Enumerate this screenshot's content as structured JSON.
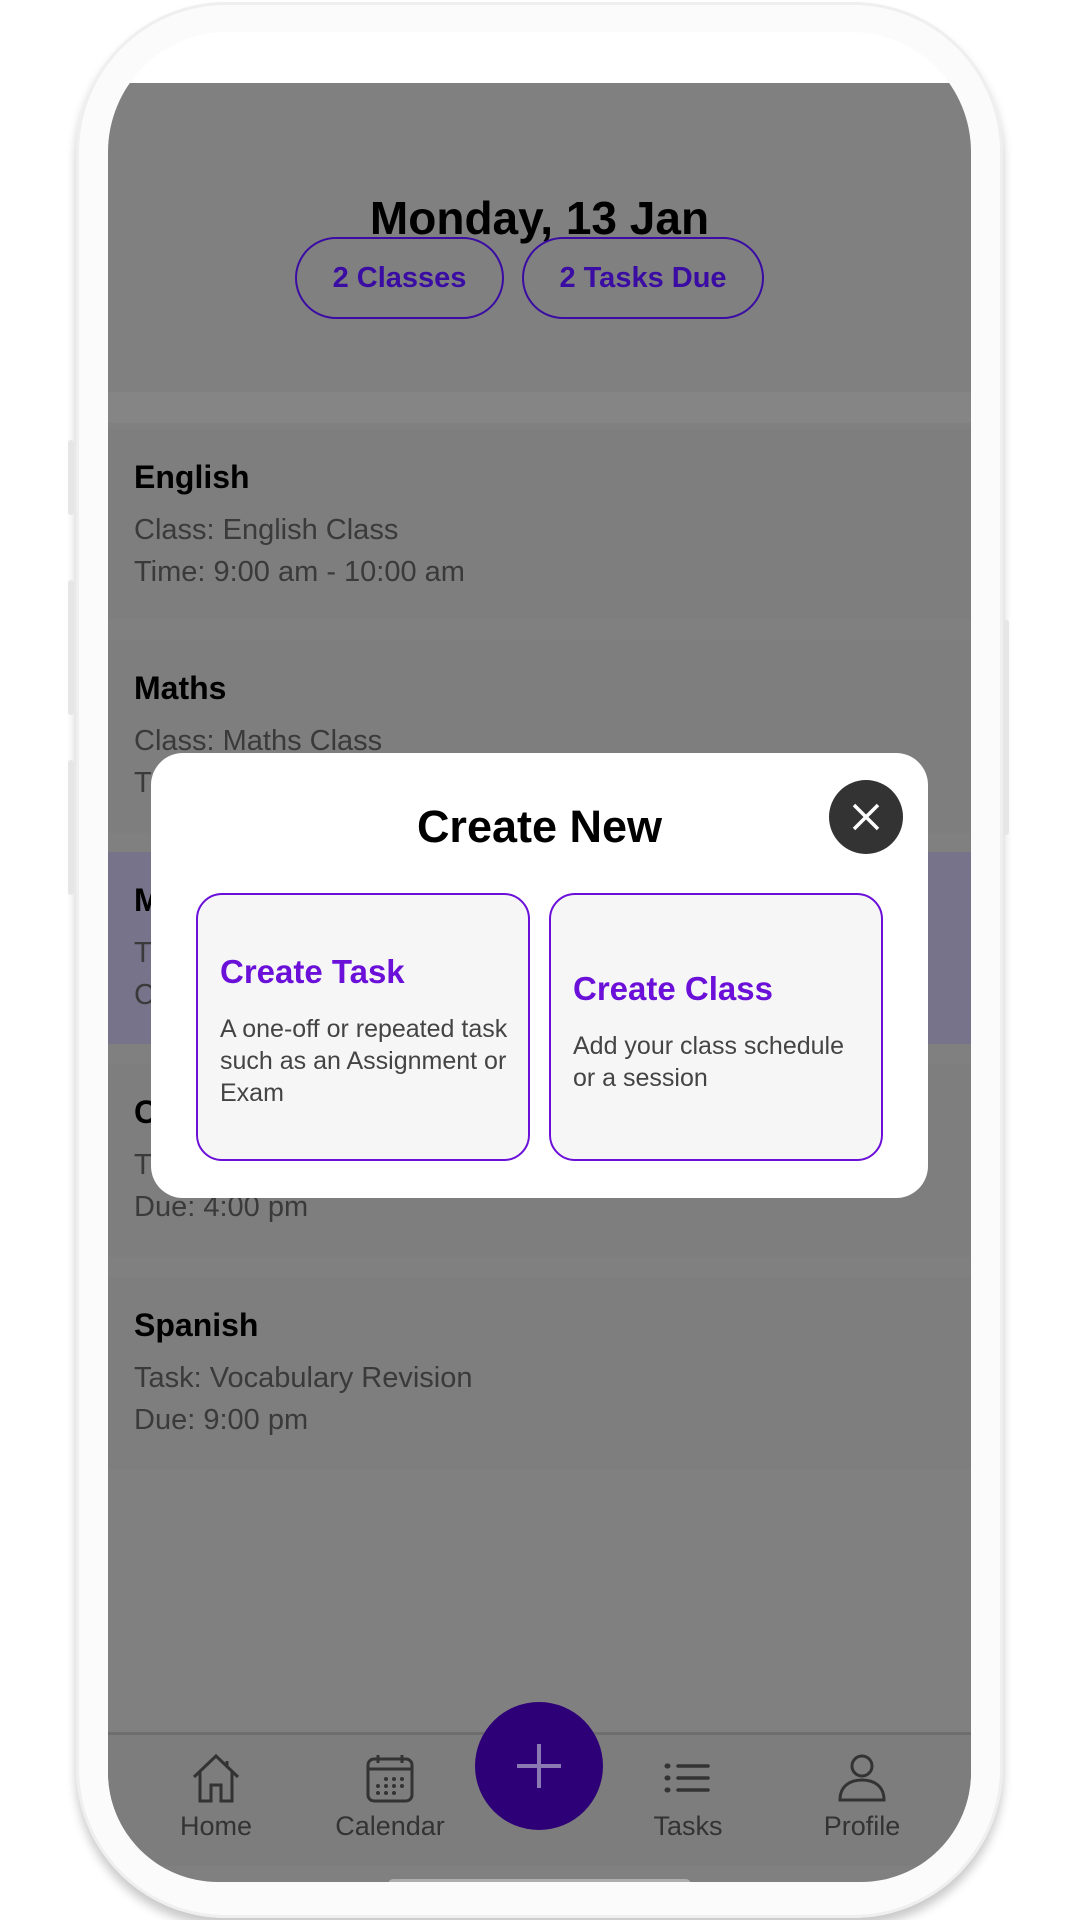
{
  "header": {
    "title": "Monday, 13 Jan",
    "classes_pill": "2 Classes",
    "tasks_pill": "2 Tasks Due"
  },
  "schedule": [
    {
      "title": "English",
      "line1": "Class: English Class",
      "line2": "Time: 9:00 am - 10:00 am"
    },
    {
      "title": "Maths",
      "line1": "Class: Maths Class",
      "line2": "T"
    },
    {
      "title": "M",
      "line1": "T",
      "line2": "C"
    },
    {
      "title": "C",
      "line1": "T",
      "line2": "Due: 4:00 pm"
    },
    {
      "title": "Spanish",
      "line1": "Task: Vocabulary Revision",
      "line2": "Due: 9:00 pm"
    }
  ],
  "modal": {
    "title": "Create New",
    "close_icon": "close-icon",
    "options": [
      {
        "title": "Create Task",
        "description": "A one-off or repeated task such as an Assignment or Exam"
      },
      {
        "title": "Create Class",
        "description": "Add your class schedule or a session"
      }
    ]
  },
  "nav": {
    "items": [
      {
        "label": "Home",
        "icon": "home-icon"
      },
      {
        "label": "Calendar",
        "icon": "calendar-icon"
      },
      {
        "label": "Tasks",
        "icon": "list-icon"
      },
      {
        "label": "Profile",
        "icon": "user-icon"
      }
    ],
    "fab_icon": "plus-icon"
  },
  "colors": {
    "accent": "#6a10d8",
    "pill": "#3a0ca3",
    "fab": "#2e0078",
    "overlay": "#808080",
    "highlight_card": "#76738a"
  }
}
